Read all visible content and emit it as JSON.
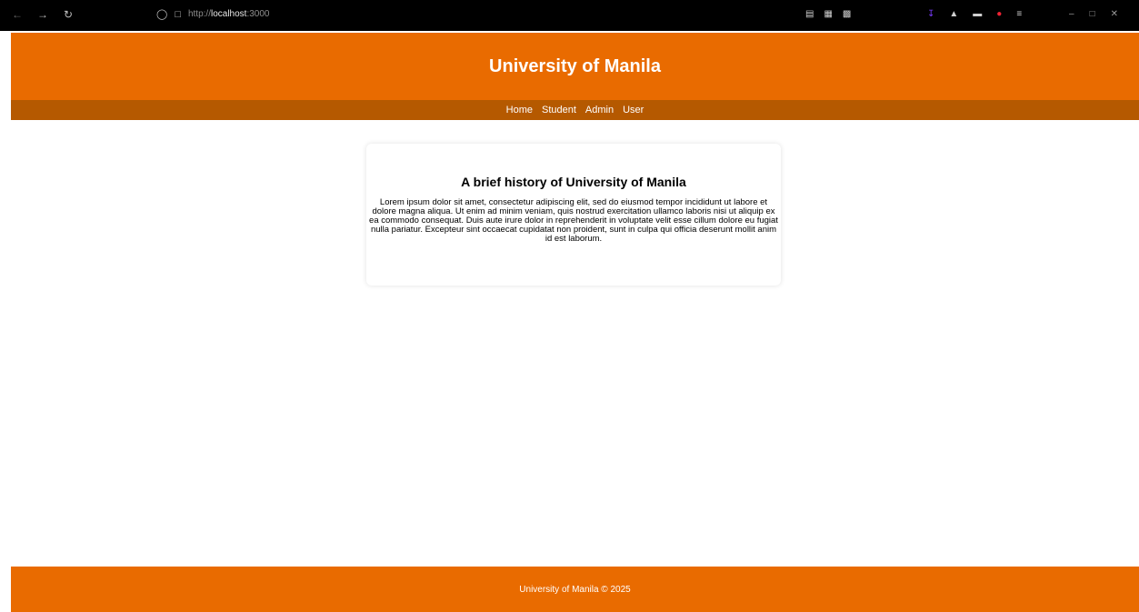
{
  "browser": {
    "url_prefix": "http://",
    "url_host": "localhost",
    "url_port": ":3000"
  },
  "colors": {
    "brand": "#e96b00",
    "brand_dark": "#b55900",
    "browser_bar": "#000000"
  },
  "header": {
    "title": "University of Manila"
  },
  "nav": {
    "items": [
      {
        "label": "Home"
      },
      {
        "label": "Student"
      },
      {
        "label": "Admin"
      },
      {
        "label": "User"
      }
    ]
  },
  "card": {
    "title": "A brief history of University of Manila",
    "body": "Lorem ipsum dolor sit amet, consectetur adipiscing elit, sed do eiusmod tempor incididunt ut labore et dolore magna aliqua. Ut enim ad minim veniam, quis nostrud exercitation ullamco laboris nisi ut aliquip ex ea commodo consequat. Duis aute irure dolor in reprehenderit in voluptate velit esse cillum dolore eu fugiat nulla pariatur. Excepteur sint occaecat cupidatat non proident, sunt in culpa qui officia deserunt mollit anim id est laborum."
  },
  "footer": {
    "text": "University of Manila © 2025"
  },
  "icons": {
    "back": "back-arrow-icon",
    "forward": "forward-arrow-icon",
    "reload": "reload-icon",
    "shield": "shield-icon",
    "page": "page-icon",
    "download": "download-icon",
    "extensions": "extensions-icon",
    "menu": "menu-icon"
  }
}
